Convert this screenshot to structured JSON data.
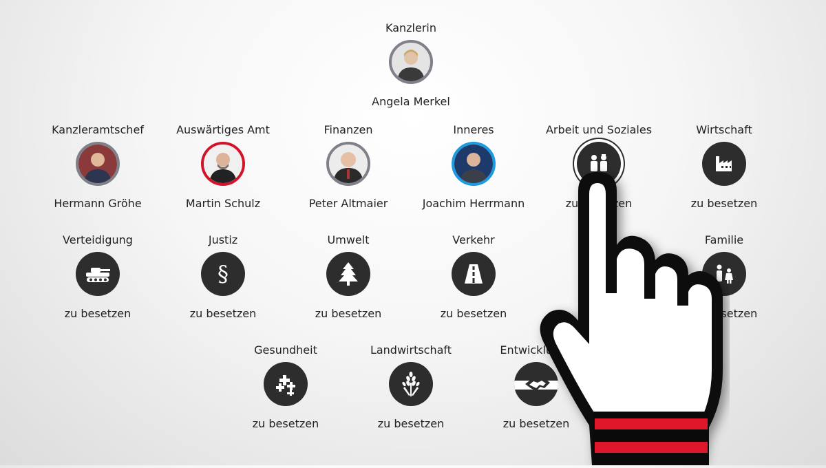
{
  "chancellor": {
    "role": "Kanzlerin",
    "name": "Angela Merkel",
    "icon": "portrait-photo",
    "ring": "#80808a"
  },
  "row1": [
    {
      "role": "Kanzleramtschef",
      "name": "Hermann Gröhe",
      "icon": "portrait-photo",
      "ring": "#80808a"
    },
    {
      "role": "Auswärtiges Amt",
      "name": "Martin Schulz",
      "icon": "portrait-photo",
      "ring": "#d2142a"
    },
    {
      "role": "Finanzen",
      "name": "Peter Altmaier",
      "icon": "portrait-photo",
      "ring": "#80808a"
    },
    {
      "role": "Inneres",
      "name": "Joachim Herrmann",
      "icon": "portrait-photo",
      "ring": "#1e9be0"
    },
    {
      "role": "Arbeit und Soziales",
      "name": "zu besetzen",
      "icon": "workers-icon"
    },
    {
      "role": "Wirtschaft",
      "name": "zu besetzen",
      "icon": "factory-icon"
    }
  ],
  "row2": [
    {
      "role": "Verteidigung",
      "name": "zu besetzen",
      "icon": "tank-icon"
    },
    {
      "role": "Justiz",
      "name": "zu besetzen",
      "icon": "paragraph-icon"
    },
    {
      "role": "Umwelt",
      "name": "zu besetzen",
      "icon": "tree-icon"
    },
    {
      "role": "Verkehr",
      "name": "zu besetzen",
      "icon": "road-icon"
    },
    {
      "role": "Familie",
      "name": "zu besetzen",
      "icon": "family-icon"
    }
  ],
  "row3": [
    {
      "role": "Gesundheit",
      "name": "zu besetzen",
      "icon": "health-crosses-icon"
    },
    {
      "role": "Landwirtschaft",
      "name": "zu besetzen",
      "icon": "wheat-icon"
    },
    {
      "role": "Entwicklungs",
      "name": "zu besetzen",
      "icon": "handshake-icon"
    }
  ],
  "colors": {
    "icon_bg": "#2d2d2d",
    "spd_red": "#d2142a",
    "csu_blue": "#1e9be0",
    "cdu_gray": "#80808a",
    "cuff_red": "#e0162b"
  },
  "overlay": {
    "icon": "pointing-hand-icon"
  }
}
